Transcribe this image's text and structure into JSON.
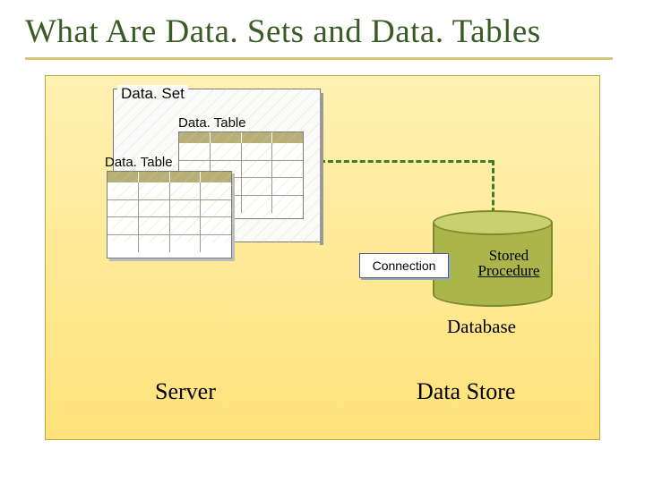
{
  "title": "What Are Data. Sets and Data. Tables",
  "dataset": {
    "label": "Data. Set",
    "table_label_back": "Data. Table",
    "table_label_front": "Data. Table"
  },
  "connection": "Connection",
  "stored_procedure": {
    "line1": "Stored",
    "line2": "Procedure"
  },
  "database": "Database",
  "server": "Server",
  "data_store": "Data Store"
}
